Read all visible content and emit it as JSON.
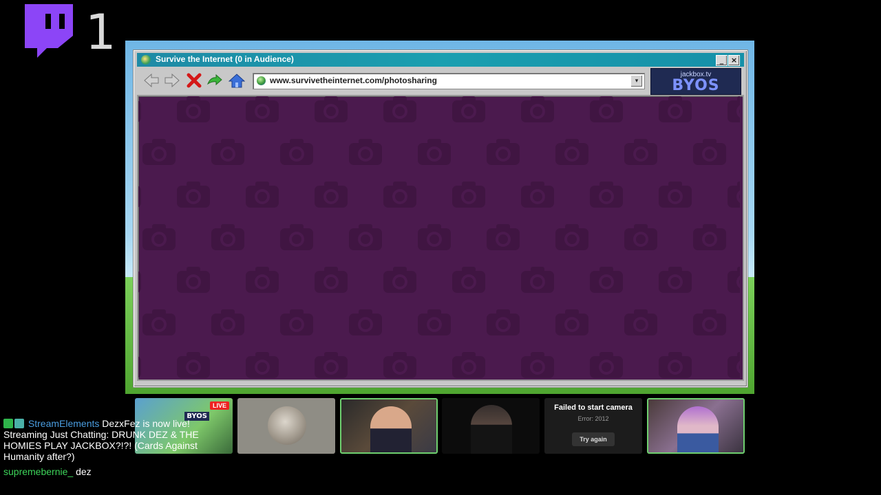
{
  "overlay": {
    "viewer_count": "1",
    "logo_icon": "twitch-icon"
  },
  "window": {
    "title": "Survive the Internet  (0 in Audience)",
    "minimize_label": "_",
    "close_label": "×"
  },
  "toolbar": {
    "address_url": "www.survivetheinternet.com/photosharing",
    "dropdown_label": "▾",
    "logo_top": "jackbox.tv",
    "logo_main": "BYOS"
  },
  "cams": {
    "live_badge": "LIVE",
    "mini_logo": "BYOS",
    "failed_title": "Failed to start camera",
    "failed_error": "Error: 2012",
    "retry_label": "Try again"
  },
  "chat": {
    "messages": [
      {
        "user": "StreamElements",
        "text": "DezxFez is now live! Streaming Just Chatting: DRUNK DEZ & THE HOMIES PLAY JACKBOX?!?! (Cards Against Humanity after?)"
      },
      {
        "user": "supremebernie_",
        "text": "dez"
      }
    ]
  },
  "colors": {
    "title_bar": "#1a9fb0",
    "content_bg": "#4b1a4e",
    "cam_border_active": "#6fd06f",
    "chat_user_bot": "#4a9de0",
    "chat_user_viewer": "#3dd55a"
  }
}
